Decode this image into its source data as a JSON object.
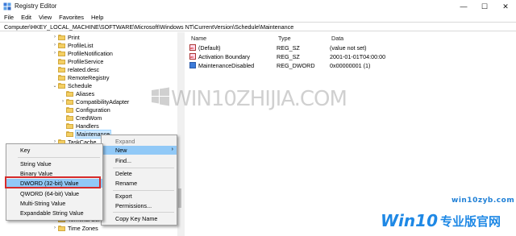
{
  "window": {
    "title": "Registry Editor",
    "min": "—",
    "max": "☐",
    "close": "✕"
  },
  "menu": [
    "File",
    "Edit",
    "View",
    "Favorites",
    "Help"
  ],
  "address": "Computer\\HKEY_LOCAL_MACHINE\\SOFTWARE\\Microsoft\\Windows NT\\CurrentVersion\\Schedule\\Maintenance",
  "tree": {
    "items": [
      {
        "label": "Print",
        "chev": "›"
      },
      {
        "label": "ProfileList",
        "chev": "›"
      },
      {
        "label": "ProfileNotification",
        "chev": "›"
      },
      {
        "label": "ProfileService",
        "chev": ""
      },
      {
        "label": "related.desc",
        "chev": ""
      },
      {
        "label": "RemoteRegistry",
        "chev": ""
      },
      {
        "label": "Schedule",
        "chev": "⌄"
      },
      {
        "label": "Aliases",
        "chev": ""
      },
      {
        "label": "CompatibilityAdapter",
        "chev": "›"
      },
      {
        "label": "Configuration",
        "chev": ""
      },
      {
        "label": "CredWom",
        "chev": ""
      },
      {
        "label": "Handlers",
        "chev": ""
      },
      {
        "label": "Maintenance",
        "chev": ""
      },
      {
        "label": "TaskCache",
        "chev": "›"
      }
    ],
    "bottom_items": [
      {
        "label": "Terminal Server",
        "chev": "›"
      },
      {
        "label": "Time Zones",
        "chev": "›"
      }
    ]
  },
  "values": {
    "headers": {
      "name": "Name",
      "type": "Type",
      "data": "Data"
    },
    "rows": [
      {
        "name": "(Default)",
        "type": "REG_SZ",
        "data": "(value not set)",
        "icon": "string-value-icon"
      },
      {
        "name": "Activation Boundary",
        "type": "REG_SZ",
        "data": "2001-01-01T04:00:00",
        "icon": "string-value-icon"
      },
      {
        "name": "MaintenanceDisabled",
        "type": "REG_DWORD",
        "data": "0x00000001 (1)",
        "icon": "dword-value-icon"
      }
    ]
  },
  "context_menu": {
    "items": [
      "Expand",
      "New",
      "Find...",
      "Delete",
      "Rename",
      "Export",
      "Permissions...",
      "Copy Key Name"
    ]
  },
  "new_submenu": {
    "items": [
      "Key",
      "String Value",
      "Binary Value",
      "DWORD (32-bit) Value",
      "QWORD (64-bit) Value",
      "Multi-String Value",
      "Expandable String Value"
    ]
  },
  "watermark": {
    "text": "WIN10ZHIJIA.COM"
  },
  "branding": {
    "site": "win10zyb.com",
    "logo_main": "Win10",
    "logo_cn": "专业版官网"
  },
  "colors": {
    "highlight": "#91c9f7",
    "selection": "#cce8ff",
    "red_box": "#d52b2b",
    "brand_blue": "#1e88e5"
  }
}
